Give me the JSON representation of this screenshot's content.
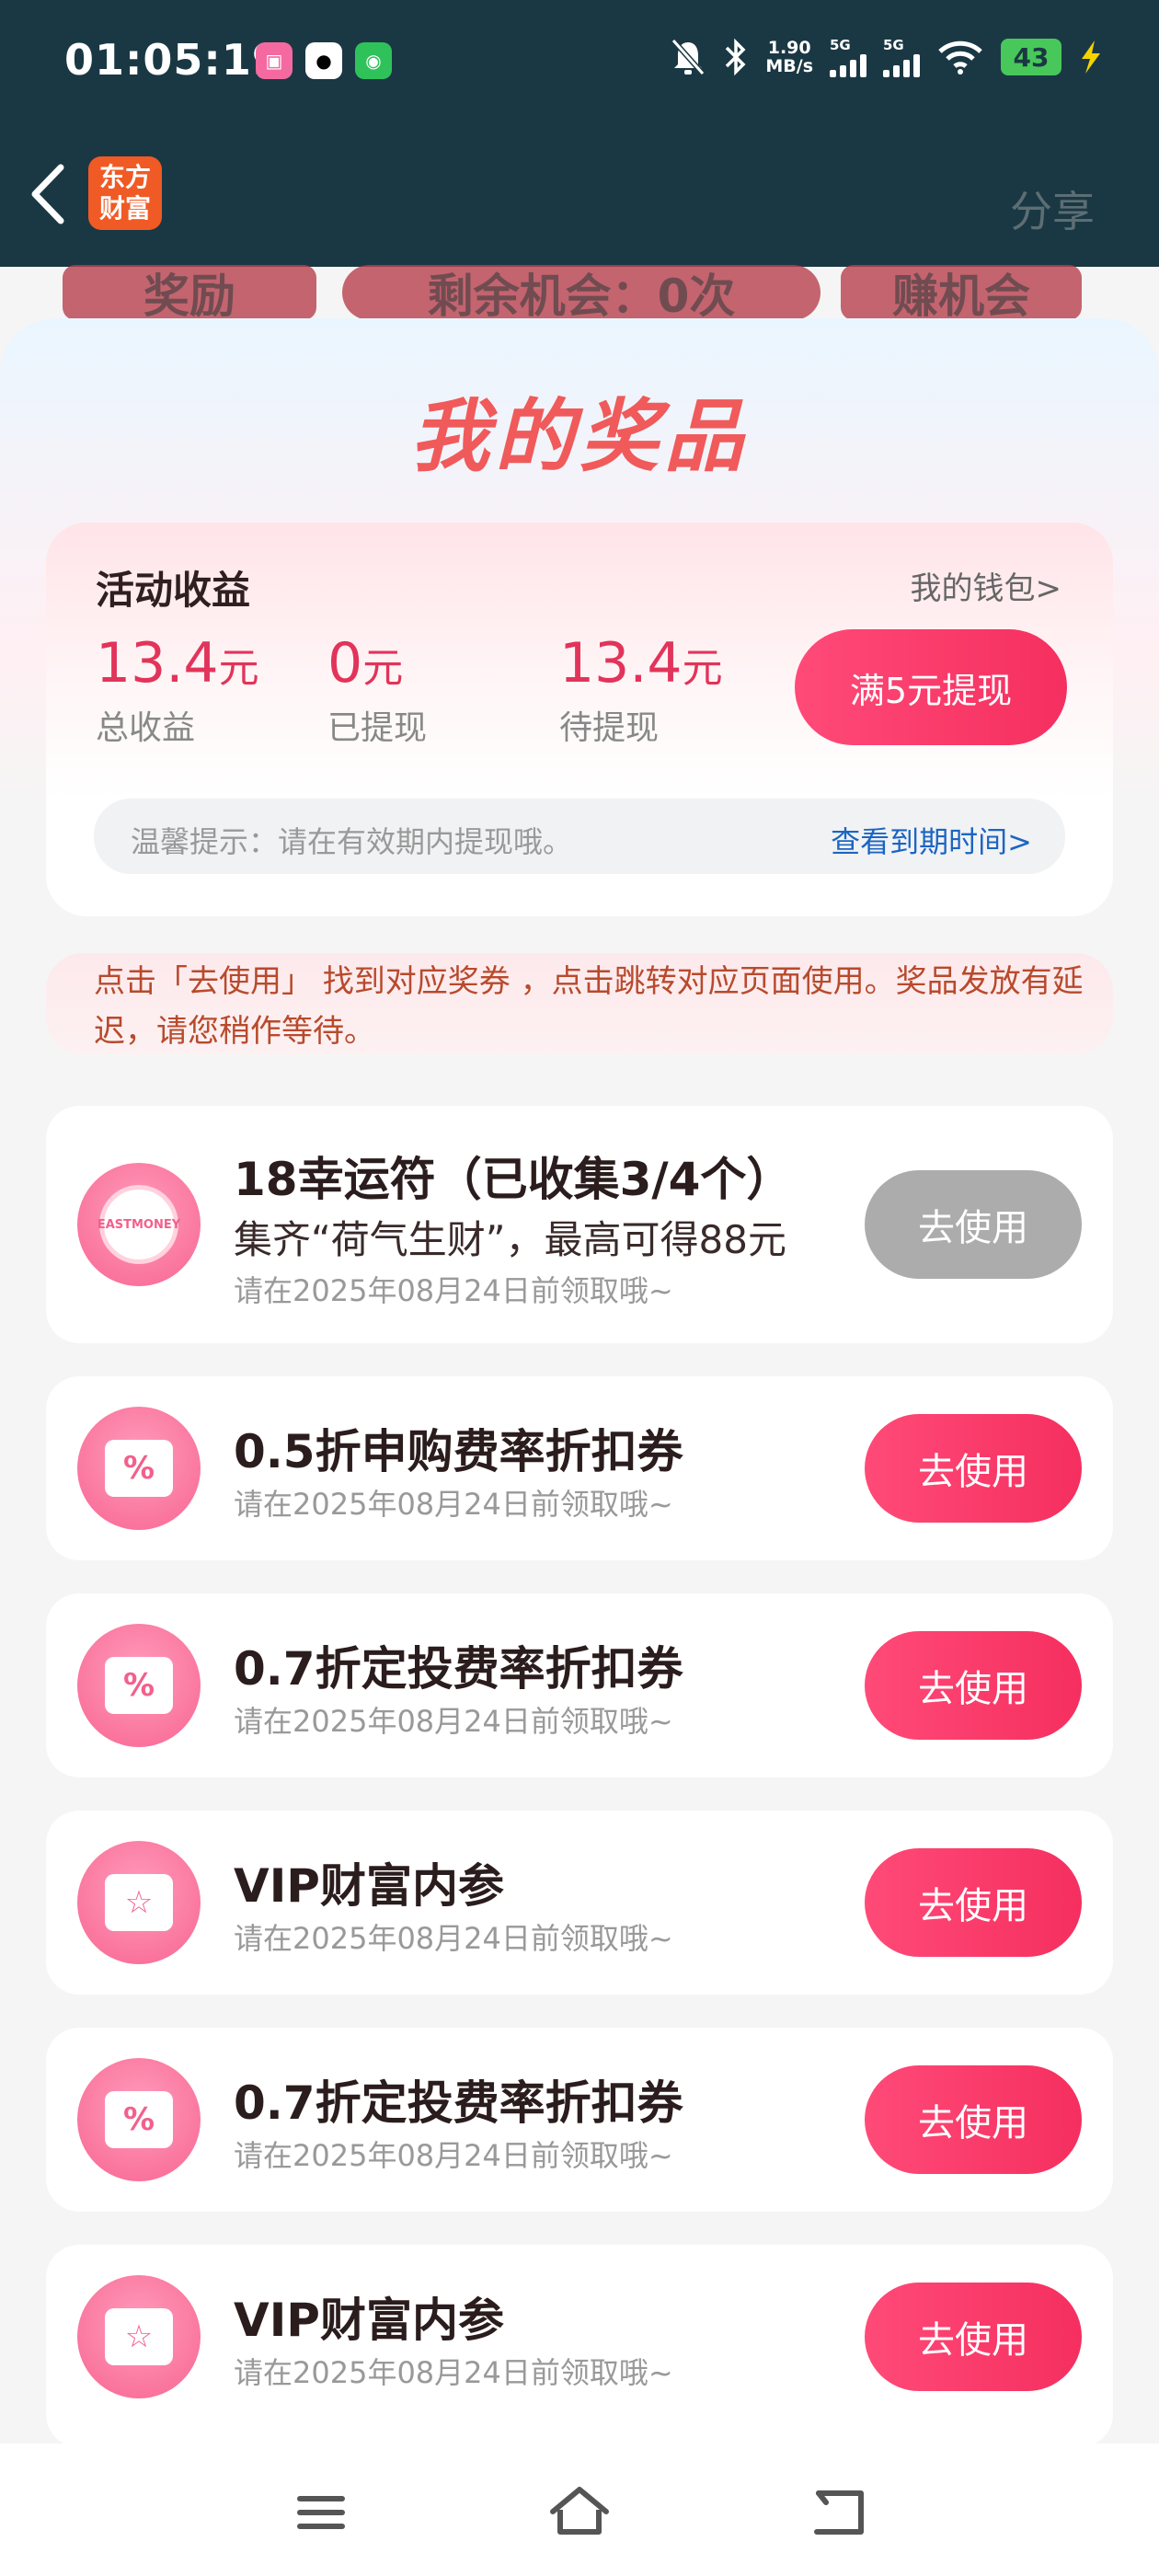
{
  "status": {
    "time": "01:05:19",
    "net_speed": "1.90",
    "net_unit": "MB/s",
    "sig1": "5G",
    "sig2": "5G",
    "battery": "43"
  },
  "header": {
    "logo_line1": "东方",
    "logo_line2": "财富",
    "share": "分享"
  },
  "peek": {
    "a": "奖励",
    "b": "剩余机会：0次",
    "c": "赚机会"
  },
  "sheet": {
    "title": "我的奖品"
  },
  "income": {
    "title": "活动收益",
    "wallet_link": "我的钱包>",
    "stats": [
      {
        "value": "13.4",
        "unit": "元",
        "label": "总收益"
      },
      {
        "value": "0",
        "unit": "元",
        "label": "已提现"
      },
      {
        "value": "13.4",
        "unit": "元",
        "label": "待提现"
      }
    ],
    "withdraw_button": "满5元提现",
    "tip": "温馨提示：请在有效期内提现哦。",
    "tip_link": "查看到期时间>"
  },
  "notice": "点击「去使用」 找到对应奖券 ，点击跳转对应页面使用。奖品发放有延迟，请您稍作等待。",
  "prizes": [
    {
      "title": "18幸运符（已收集3/4个）",
      "subtitle": "集齐“荷气生财”，最高可得88元",
      "date": "请在2025年08月24日前领取哦~",
      "button": "去使用",
      "icon": "EASTMONEY",
      "icon_name": "lucky-charm-coin-icon"
    },
    {
      "title": "0.5折申购费率折扣券",
      "date": "请在2025年08月24日前领取哦~",
      "button": "去使用",
      "icon": "%",
      "icon_name": "discount-coupon-icon"
    },
    {
      "title": "0.7折定投费率折扣券",
      "date": "请在2025年08月24日前领取哦~",
      "button": "去使用",
      "icon": "%",
      "icon_name": "discount-coupon-icon"
    },
    {
      "title": "VIP财富内参",
      "date": "请在2025年08月24日前领取哦~",
      "button": "去使用",
      "icon": "☆",
      "icon_name": "vip-star-coupon-icon"
    },
    {
      "title": "0.7折定投费率折扣券",
      "date": "请在2025年08月24日前领取哦~",
      "button": "去使用",
      "icon": "%",
      "icon_name": "discount-coupon-icon"
    },
    {
      "title": "VIP财富内参",
      "date": "请在2025年08月24日前领取哦~",
      "button": "去使用",
      "icon": "☆",
      "icon_name": "vip-star-coupon-icon"
    }
  ]
}
